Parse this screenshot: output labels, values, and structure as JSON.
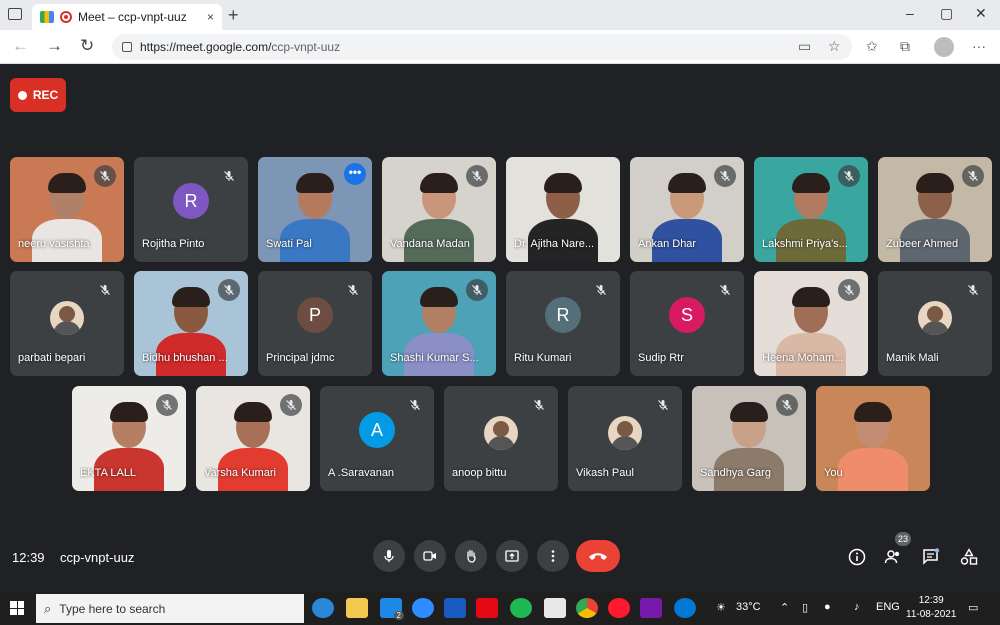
{
  "browser": {
    "tab_title": "Meet – ccp-vnpt-uuz",
    "url_host": "https://meet.google.com/",
    "url_path": "ccp-vnpt-uuz",
    "new_tab": "+",
    "minimize": "–",
    "maximize": "▢",
    "close": "✕",
    "tab_close": "×",
    "more": "···"
  },
  "rec": {
    "label": "REC"
  },
  "participants": [
    {
      "name": "neeru vasishta",
      "muted": true,
      "kind": "video",
      "bg": "#c97a54",
      "skin": "#b08068",
      "shirt": "#e9e5e2"
    },
    {
      "name": "Rojitha Pinto",
      "muted": true,
      "kind": "avatar",
      "initial": "R",
      "color": "#7e57c2"
    },
    {
      "name": "Swati Pal",
      "muted": false,
      "kind": "video",
      "bg": "#7d96b5",
      "skin": "#b37a5e",
      "shirt": "#3a78c4",
      "active": true
    },
    {
      "name": "Vandana Madan",
      "muted": true,
      "kind": "video",
      "bg": "#d6d2cc",
      "skin": "#c9967c",
      "shirt": "#556b5a"
    },
    {
      "name": "Dr. Ajitha Nare...",
      "muted": false,
      "kind": "video",
      "bg": "#e3e1dc",
      "skin": "#8e5f47",
      "shirt": "#242424"
    },
    {
      "name": "Ankan Dhar",
      "muted": true,
      "kind": "video",
      "bg": "#d2cfc8",
      "skin": "#c99a7a",
      "shirt": "#3050a0"
    },
    {
      "name": "Lakshmi Priya's...",
      "muted": true,
      "kind": "video",
      "bg": "#3aa6a0",
      "skin": "#b07b60",
      "shirt": "#6d6a3a"
    },
    {
      "name": "Zubeer Ahmed",
      "muted": true,
      "kind": "video",
      "bg": "#c3b9a6",
      "skin": "#8c6049",
      "shirt": "#5e6670"
    },
    {
      "name": "parbati bepari",
      "muted": true,
      "kind": "thumb"
    },
    {
      "name": "Bidhu bhushan ...",
      "muted": true,
      "kind": "video",
      "bg": "#a9c4d6",
      "skin": "#8a5a40",
      "shirt": "#d02a2a"
    },
    {
      "name": "Principal jdmc",
      "muted": true,
      "kind": "avatar",
      "initial": "P",
      "color": "#6d4c41"
    },
    {
      "name": "Shashi Kumar S...",
      "muted": true,
      "kind": "video",
      "bg": "#4ea2b8",
      "skin": "#b17f63",
      "shirt": "#8b8fc6"
    },
    {
      "name": "Ritu Kumari",
      "muted": true,
      "kind": "avatar",
      "initial": "R",
      "color": "#546e7a"
    },
    {
      "name": "Sudip Rtr",
      "muted": true,
      "kind": "avatar",
      "initial": "S",
      "color": "#d81b60"
    },
    {
      "name": "Heena Moham...",
      "muted": true,
      "kind": "video",
      "bg": "#e5ddd7",
      "skin": "#a06e56",
      "shirt": "#d9b9a5"
    },
    {
      "name": "Manik Mali",
      "muted": true,
      "kind": "thumb"
    },
    {
      "name": "EKTA LALL",
      "muted": true,
      "kind": "video",
      "bg": "#eeece8",
      "skin": "#b57f64",
      "shirt": "#c9352f"
    },
    {
      "name": "Varsha Kumari",
      "muted": true,
      "kind": "video",
      "bg": "#e9e6e1",
      "skin": "#a87157",
      "shirt": "#e23c30"
    },
    {
      "name": "A .Saravanan",
      "muted": true,
      "kind": "avatar",
      "initial": "A",
      "color": "#039be5"
    },
    {
      "name": "anoop bittu",
      "muted": true,
      "kind": "thumb"
    },
    {
      "name": "Vikash Paul",
      "muted": true,
      "kind": "thumb"
    },
    {
      "name": "Sandhya Garg",
      "muted": true,
      "kind": "video",
      "bg": "#c7c1b9",
      "skin": "#c9a088",
      "shirt": "#8c7b6a"
    },
    {
      "name": "You",
      "muted": false,
      "kind": "video",
      "bg": "#c98658",
      "skin": "#c28d73",
      "shirt": "#ef8d6b"
    }
  ],
  "footer": {
    "time": "12:39",
    "meeting_code": "ccp-vnpt-uuz",
    "participant_count": "23"
  },
  "taskbar": {
    "search_placeholder": "Type here to search",
    "weather": "33°C",
    "language": "ENG",
    "time": "12:39",
    "date": "11-08-2021",
    "mail_badge": "2"
  }
}
